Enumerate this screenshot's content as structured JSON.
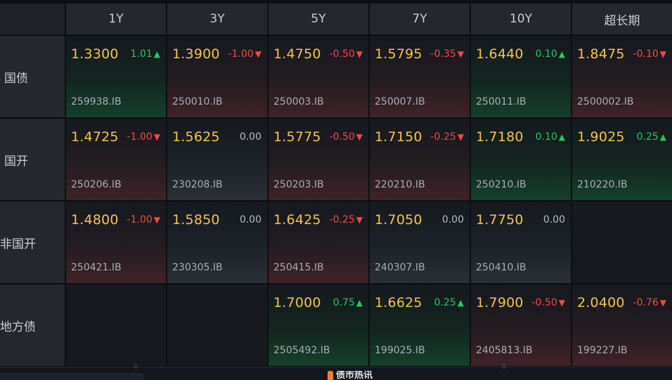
{
  "columns": [
    "1Y",
    "3Y",
    "5Y",
    "7Y",
    "10Y",
    "超长期"
  ],
  "rows": [
    {
      "label": "国债",
      "cells": [
        {
          "yield": "1.3300",
          "change": "1.01",
          "direction": "up",
          "code": "259938.IB"
        },
        {
          "yield": "1.3900",
          "change": "-1.00",
          "direction": "down",
          "code": "250010.IB"
        },
        {
          "yield": "1.4750",
          "change": "-0.50",
          "direction": "down",
          "code": "250003.IB"
        },
        {
          "yield": "1.5795",
          "change": "-0.35",
          "direction": "down",
          "code": "250007.IB"
        },
        {
          "yield": "1.6440",
          "change": "0.10",
          "direction": "up",
          "code": "250011.IB"
        },
        {
          "yield": "1.8475",
          "change": "-0.10",
          "direction": "down",
          "code": "2500002.IB"
        }
      ]
    },
    {
      "label": "国开",
      "cells": [
        {
          "yield": "1.4725",
          "change": "-1.00",
          "direction": "down",
          "code": "250206.IB"
        },
        {
          "yield": "1.5625",
          "change": "0.00",
          "direction": "flat",
          "code": "230208.IB"
        },
        {
          "yield": "1.5775",
          "change": "-0.50",
          "direction": "down",
          "code": "250203.IB"
        },
        {
          "yield": "1.7150",
          "change": "-0.25",
          "direction": "down",
          "code": "220210.IB"
        },
        {
          "yield": "1.7180",
          "change": "0.10",
          "direction": "up",
          "code": "250210.IB"
        },
        {
          "yield": "1.9025",
          "change": "0.25",
          "direction": "up",
          "code": "210220.IB"
        }
      ]
    },
    {
      "label": "非国开",
      "cells": [
        {
          "yield": "1.4800",
          "change": "-1.00",
          "direction": "down",
          "code": "250421.IB"
        },
        {
          "yield": "1.5850",
          "change": "0.00",
          "direction": "flat",
          "code": "230305.IB"
        },
        {
          "yield": "1.6425",
          "change": "-0.25",
          "direction": "down",
          "code": "250415.IB"
        },
        {
          "yield": "1.7050",
          "change": "0.00",
          "direction": "flat",
          "code": "240307.IB"
        },
        {
          "yield": "1.7750",
          "change": "0.00",
          "direction": "flat",
          "code": "250410.IB"
        },
        null
      ]
    },
    {
      "label": "地方债",
      "cells": [
        null,
        null,
        {
          "yield": "1.7000",
          "change": "0.75",
          "direction": "up",
          "code": "2505492.IB"
        },
        {
          "yield": "1.6625",
          "change": "0.25",
          "direction": "up",
          "code": "199025.IB"
        },
        {
          "yield": "1.7900",
          "change": "-0.50",
          "direction": "down",
          "code": "2405813.IB"
        },
        {
          "yield": "2.0400",
          "change": "-0.76",
          "direction": "down",
          "code": "199227.IB"
        }
      ]
    }
  ],
  "arrows": {
    "up": "▲",
    "down": "▼"
  },
  "colors": {
    "yield": "#f3c44f",
    "up": "#2fc262",
    "down": "#f04a4a",
    "flat": "#b8bcc2"
  },
  "bottom_panel": {
    "title": "债市热讯",
    "icon": "bookmark-icon"
  }
}
